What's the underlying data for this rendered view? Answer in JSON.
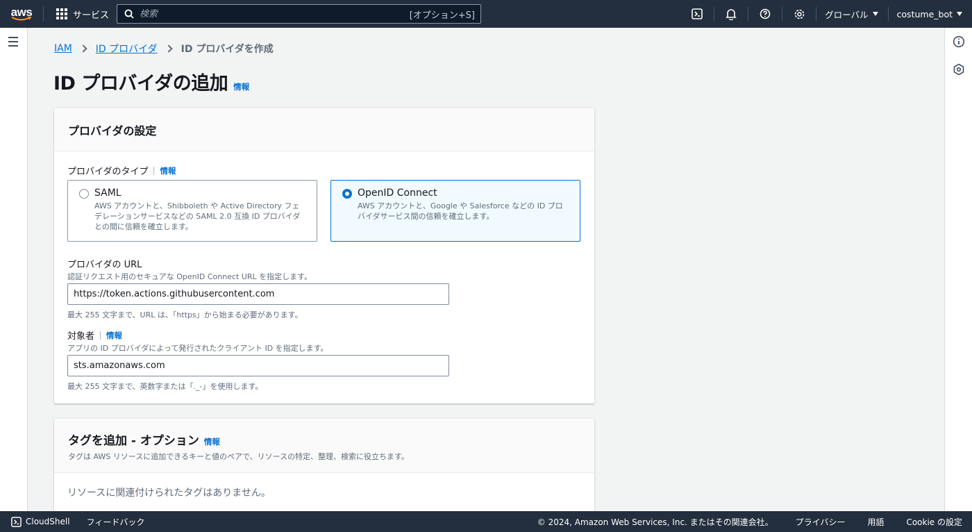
{
  "topnav": {
    "logo_text": "aws",
    "services_label": "サービス",
    "search_placeholder": "検索",
    "search_shortcut": "[オプション+S]",
    "region_label": "グローバル",
    "account_label": "costume_bot"
  },
  "breadcrumb": {
    "items": [
      "IAM",
      "ID プロバイダ"
    ],
    "current": "ID プロバイダを作成"
  },
  "page": {
    "title": "ID プロバイダの追加",
    "info": "情報"
  },
  "provider_settings": {
    "heading": "プロバイダの設定",
    "type_label": "プロバイダのタイプ",
    "type_info": "情報",
    "options": [
      {
        "title": "SAML",
        "desc_lines": [
          "AWS アカウントと、Shibboleth や Active Directory フェ",
          "デレーションサービスなどの SAML 2.0 互換 ID プロバイダ",
          "との間に信頼を確立します。"
        ],
        "selected": false
      },
      {
        "title": "OpenID Connect",
        "desc_lines": [
          "AWS アカウントと、Google や Salesforce などの ID プロ",
          "バイダサービス間の信頼を確立します。"
        ],
        "selected": true
      }
    ],
    "url_label": "プロバイダの URL",
    "url_desc": "認証リクエスト用のセキュアな OpenID Connect URL を指定します。",
    "url_value": "https://token.actions.githubusercontent.com",
    "url_hint": "最大 255 文字まで、URL は、「https」から始まる必要があります。",
    "audience_label": "対象者",
    "audience_info": "情報",
    "audience_desc": "アプリの ID プロバイダによって発行されたクライアント ID を指定します。",
    "audience_value": "sts.amazonaws.com",
    "audience_hint": "最大 255 文字まで、英数字または「._-」を使用します。"
  },
  "tags": {
    "heading": "タグを追加 - オプション",
    "info": "情報",
    "desc": "タグは AWS リソースに追加できるキーと値のペアで、リソースの特定、整理、検索に役立ちます。",
    "empty": "リソースに関連付けられたタグはありません。"
  },
  "footer": {
    "cloudshell": "CloudShell",
    "feedback": "フィードバック",
    "copyright": "© 2024, Amazon Web Services, Inc. またはその関連会社。",
    "privacy": "プライバシー",
    "terms": "用語",
    "cookie": "Cookie の設定"
  },
  "colors": {
    "nav_bg": "#232f3e",
    "link": "#0972d3",
    "selected_bg": "#f1faff"
  }
}
